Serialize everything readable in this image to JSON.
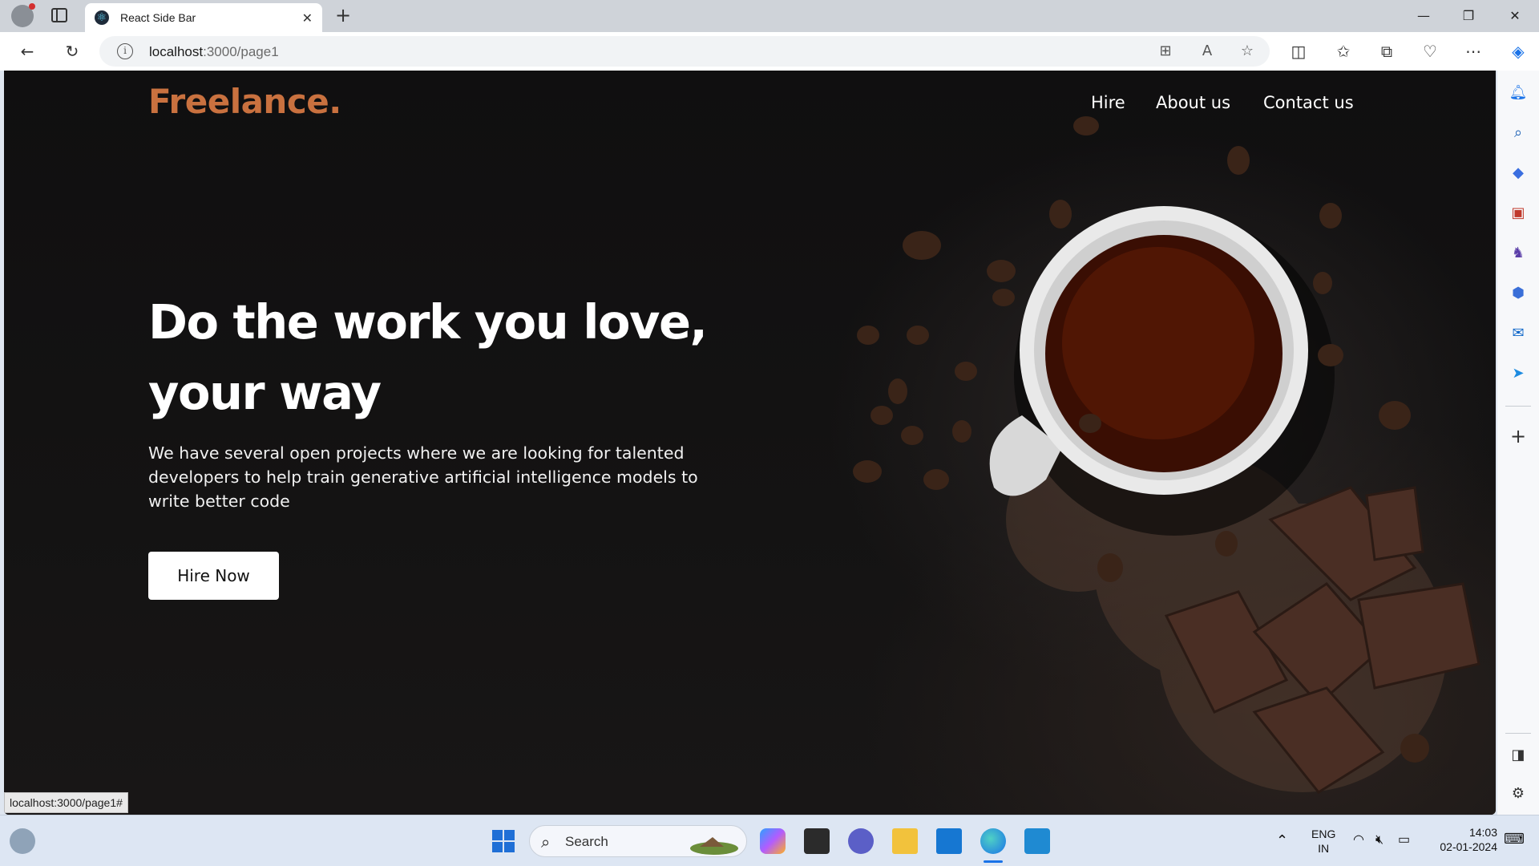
{
  "browser": {
    "tab_title": "React Side Bar",
    "url_host": "localhost",
    "url_path": ":3000/page1",
    "status_url": "localhost:3000/page1#"
  },
  "site": {
    "logo": "Freelance.",
    "nav": [
      "Hire",
      "About us",
      "Contact us"
    ],
    "headline_line1": "Do the work you love,",
    "headline_line2": "your way",
    "subtext": "We have several open projects where we are looking for talented developers to help train generative artificial intelligence models to write better code",
    "cta": "Hire Now",
    "accent_color": "#c9713f"
  },
  "taskbar": {
    "search_placeholder": "Search",
    "lang_line1": "ENG",
    "lang_line2": "IN",
    "time": "14:03",
    "date": "02-01-2024"
  },
  "icons": {
    "sidebar": [
      "bell-icon",
      "search-icon",
      "tag-icon",
      "toolbox-icon",
      "chess-icon",
      "copilot-icon",
      "outlook-icon",
      "send-icon",
      "add-icon",
      "sidebar-toggle-icon",
      "settings-icon"
    ]
  }
}
